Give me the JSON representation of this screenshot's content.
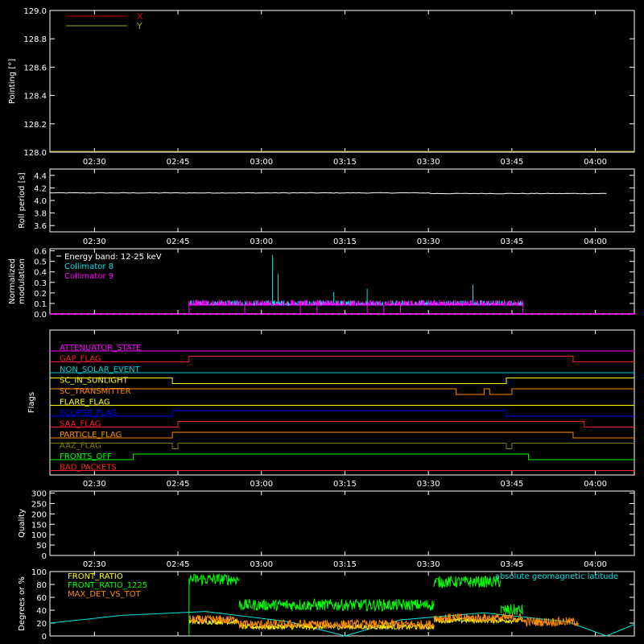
{
  "x_axis": {
    "start": "02:22",
    "end": "04:07",
    "tick_labels": [
      "02:30",
      "02:45",
      "03:00",
      "03:15",
      "03:30",
      "03:45",
      "04:00"
    ]
  },
  "chart_data": [
    {
      "type": "line",
      "ylabel": "Pointing [°]",
      "ylim": [
        128.0,
        129.0
      ],
      "y_ticks": [
        "128.0",
        "128.2",
        "128.4",
        "128.6",
        "128.8",
        "129.0"
      ],
      "legend_position": "top-left",
      "series": [
        {
          "name": "X",
          "color": "#cc0000",
          "values": []
        },
        {
          "name": "Y",
          "color": "#a0a020",
          "values": []
        }
      ]
    },
    {
      "type": "line",
      "ylabel": "Roll period [s]",
      "ylim": [
        3.5,
        4.5
      ],
      "y_ticks": [
        "3.6",
        "3.8",
        "4.0",
        "4.2",
        "4.4"
      ],
      "series": [
        {
          "color": "#ffffff",
          "x": [
            "02:22",
            "04:02"
          ],
          "values": [
            4.12,
            4.12
          ]
        }
      ]
    },
    {
      "type": "bar",
      "ylabel_lines": [
        "Normalized",
        "modulation"
      ],
      "ylim": [
        0,
        0.62
      ],
      "y_ticks": [
        "0.0",
        "0.1",
        "0.2",
        "0.3",
        "0.4",
        "0.5",
        "0.6"
      ],
      "legend_position": "top-left",
      "legend": [
        {
          "label": "Energy band: 12-25 keV",
          "color": "#ffffff"
        },
        {
          "label": "Collimator 8",
          "color": "#00e5e5"
        },
        {
          "label": "Collimator 9",
          "color": "#ff00ff"
        }
      ],
      "active_start": "02:47",
      "active_end": "03:47",
      "baseline": 0.1,
      "spikes_col8": [
        {
          "t": "03:02",
          "v": 0.56
        },
        {
          "t": "03:03",
          "v": 0.38
        },
        {
          "t": "03:19",
          "v": 0.24
        },
        {
          "t": "03:38",
          "v": 0.28
        },
        {
          "t": "03:13",
          "v": 0.21
        }
      ]
    },
    {
      "type": "line",
      "ylabel": "Flags",
      "flags": [
        {
          "name": "ATTENUATOR_STATE",
          "color": "#ff00ff",
          "steps": []
        },
        {
          "name": "GAP_FLAG",
          "color": "#ff2020",
          "steps": [
            [
              "02:22",
              1
            ],
            [
              "02:47",
              0
            ],
            [
              "03:56",
              1
            ]
          ]
        },
        {
          "name": "NON_SOLAR_EVENT",
          "color": "#00d0d0",
          "steps": []
        },
        {
          "name": "SC_IN_SUNLIGHT",
          "color": "#ffff00",
          "steps": [
            [
              "02:22",
              0
            ],
            [
              "02:44",
              1
            ],
            [
              "03:44",
              0
            ]
          ]
        },
        {
          "name": "SC_TRANSMITTER",
          "color": "#ff8c00",
          "steps": [
            [
              "02:22",
              0
            ],
            [
              "03:35",
              1
            ],
            [
              "03:40",
              0
            ],
            [
              "03:41",
              1
            ],
            [
              "03:45",
              0
            ]
          ]
        },
        {
          "name": "FLARE_FLAG",
          "color": "#ffff00",
          "steps": []
        },
        {
          "name": "ECLIPSE_FLAG",
          "color": "#0000ff",
          "steps": [
            [
              "02:22",
              1
            ],
            [
              "02:44",
              0
            ],
            [
              "03:44",
              1
            ]
          ]
        },
        {
          "name": "SAA_FLAG",
          "color": "#ff2020",
          "steps": [
            [
              "02:22",
              1
            ],
            [
              "02:45",
              0
            ],
            [
              "03:58",
              1
            ]
          ]
        },
        {
          "name": "PARTICLE_FLAG",
          "color": "#ff8c00",
          "steps": [
            [
              "02:22",
              1
            ],
            [
              "02:44",
              0
            ],
            [
              "03:56",
              1
            ]
          ]
        },
        {
          "name": "AAZ_FLAG",
          "color": "#808000",
          "steps": [
            [
              "02:22",
              0
            ],
            [
              "02:44",
              1
            ],
            [
              "02:45",
              0
            ],
            [
              "03:44",
              1
            ],
            [
              "03:45",
              0
            ]
          ]
        },
        {
          "name": "FRONTS_OFF",
          "color": "#00ff00",
          "steps": [
            [
              "02:22",
              1
            ],
            [
              "02:37",
              0
            ],
            [
              "03:48",
              1
            ]
          ]
        },
        {
          "name": "BAD_PACKETS",
          "color": "#ff2020",
          "steps": []
        }
      ]
    },
    {
      "type": "line",
      "ylabel": "Quality",
      "ylim": [
        0,
        310
      ],
      "y_ticks": [
        "0",
        "50",
        "100",
        "150",
        "200",
        "250",
        "300"
      ],
      "series": []
    },
    {
      "type": "line",
      "ylabel": "Degrees or %",
      "ylim": [
        0,
        100
      ],
      "y_ticks": [
        "0",
        "20",
        "40",
        "60",
        "80",
        "100"
      ],
      "legend_position": "top-left",
      "legend": [
        {
          "label": "FRONT_RATIO",
          "color": "#ffff00"
        },
        {
          "label": "FRONT_RATIO_1225",
          "color": "#00ff00"
        },
        {
          "label": "MAX_DET_VS_TOT",
          "color": "#ff8c00"
        }
      ],
      "right_label": {
        "label": "absolute geomagnetic latitude",
        "color": "#00e5e5"
      },
      "geomag": {
        "x": [
          "02:22",
          "02:35",
          "02:50",
          "03:05",
          "03:15",
          "03:25",
          "03:40",
          "03:55",
          "04:02",
          "04:07"
        ],
        "values": [
          20,
          32,
          38,
          22,
          0,
          25,
          36,
          22,
          0,
          18
        ]
      },
      "front_ratio_1225_segments": [
        {
          "start": "02:47",
          "end": "02:56",
          "level": 88
        },
        {
          "start": "02:56",
          "end": "03:31",
          "level": 48
        },
        {
          "start": "03:31",
          "end": "03:43",
          "level": 84
        },
        {
          "start": "03:43",
          "end": "03:47",
          "level": 40
        }
      ],
      "max_det_segments": [
        {
          "start": "02:47",
          "end": "02:56",
          "level": 25
        },
        {
          "start": "02:56",
          "end": "03:31",
          "level": 18
        },
        {
          "start": "03:31",
          "end": "03:47",
          "level": 28
        },
        {
          "start": "03:47",
          "end": "03:57",
          "level": 22
        }
      ],
      "front_ratio_segments": [
        {
          "start": "02:47",
          "end": "02:56",
          "level": 22
        },
        {
          "start": "02:56",
          "end": "03:31",
          "level": 14
        },
        {
          "start": "03:31",
          "end": "03:47",
          "level": 24
        }
      ]
    }
  ]
}
